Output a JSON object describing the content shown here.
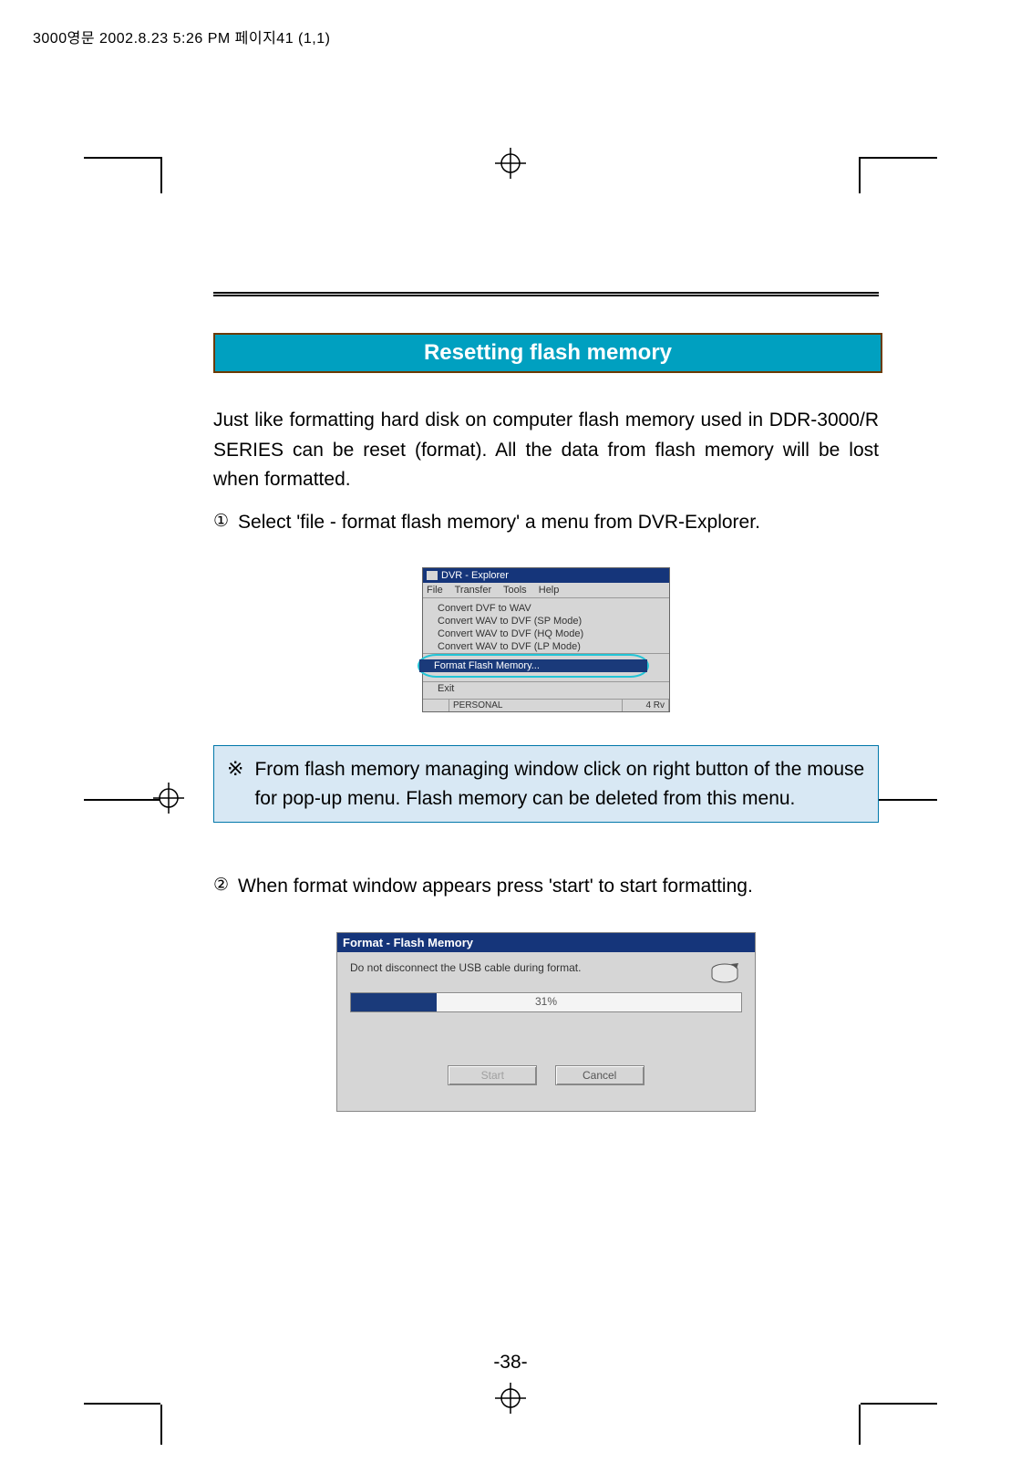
{
  "print_header": "3000영문   2002.8.23 5:26 PM  페이지41 (1,1)",
  "section_title": "Resetting flash memory",
  "intro_para": "Just like formatting hard disk on computer flash memory used in DDR-3000/R SERIES can be reset (format). All the data from flash memory will be lost when formatted.",
  "steps": {
    "s1": {
      "num": "①",
      "text": "Select 'file - format flash memory' a menu from DVR-Explorer."
    },
    "s2": {
      "num": "②",
      "text": "When format window appears press 'start' to start formatting."
    }
  },
  "note": {
    "symbol": "※",
    "text": "From flash memory managing window click on right button of the mouse for pop-up menu. Flash memory can be deleted from this menu."
  },
  "shot1": {
    "title": "DVR - Explorer",
    "menu": {
      "m1": "File",
      "m2": "Transfer",
      "m3": "Tools",
      "m4": "Help"
    },
    "items": {
      "i1": "Convert DVF to WAV",
      "i2": "Convert WAV to DVF (SP Mode)",
      "i3": "Convert WAV to DVF (HQ Mode)",
      "i4": "Convert WAV to DVF (LP Mode)",
      "hl": "Format Flash Memory...",
      "exit": "Exit"
    },
    "status": {
      "a": "PERSONAL",
      "b": "4 Rv"
    }
  },
  "shot2": {
    "title": "Format - Flash Memory",
    "msg": "Do not disconnect the USB cable during format.",
    "pct": "31%",
    "btn_start": "Start",
    "btn_cancel": "Cancel"
  },
  "page_number": "-38-"
}
